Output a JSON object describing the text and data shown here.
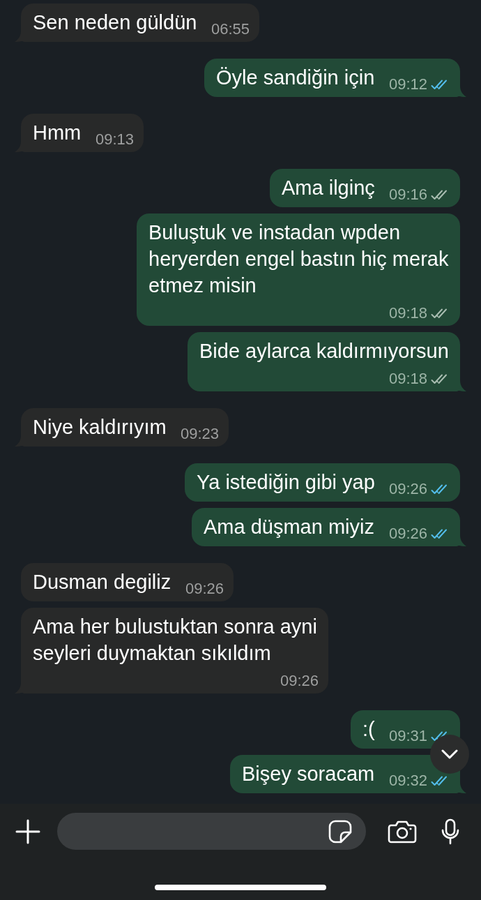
{
  "messages": [
    {
      "kind": "incoming",
      "text": "Sen neden güldün",
      "time": "06:55",
      "tail": true
    },
    {
      "kind": "outgoing",
      "text": "Öyle sandiğin için",
      "time": "09:12",
      "read": true,
      "tail": true
    },
    {
      "kind": "incoming",
      "text": "Hmm",
      "time": "09:13",
      "tail": true
    },
    {
      "kind": "outgoing",
      "text": "Ama ilginç",
      "time": "09:16",
      "read": false,
      "tail": false
    },
    {
      "kind": "outgoing",
      "text": "Buluştuk ve instadan wpden heryerden engel bastın hiç merak etmez misin",
      "time": "09:18",
      "read": false,
      "tail": false
    },
    {
      "kind": "outgoing",
      "text": "Bide aylarca kaldırmıyorsun",
      "time": "09:18",
      "read": false,
      "tail": true
    },
    {
      "kind": "incoming",
      "text": "Niye kaldırıyım",
      "time": "09:23",
      "tail": true
    },
    {
      "kind": "outgoing",
      "text": "Ya istediğin gibi yap",
      "time": "09:26",
      "read": true,
      "tail": false
    },
    {
      "kind": "outgoing",
      "text": "Ama düşman miyiz",
      "time": "09:26",
      "read": true,
      "tail": true
    },
    {
      "kind": "incoming",
      "text": "Dusman degiliz",
      "time": "09:26",
      "tail": false
    },
    {
      "kind": "incoming",
      "text": "Ama her bulustuktan sonra ayni seyleri duymaktan sıkıldım",
      "time": "09:26",
      "tail": true
    },
    {
      "kind": "outgoing",
      "text": ":(",
      "time": "09:31",
      "read": true,
      "tail": false
    },
    {
      "kind": "outgoing",
      "text": "Bişey soracam",
      "time": "09:32",
      "read": true,
      "tail": true
    }
  ]
}
